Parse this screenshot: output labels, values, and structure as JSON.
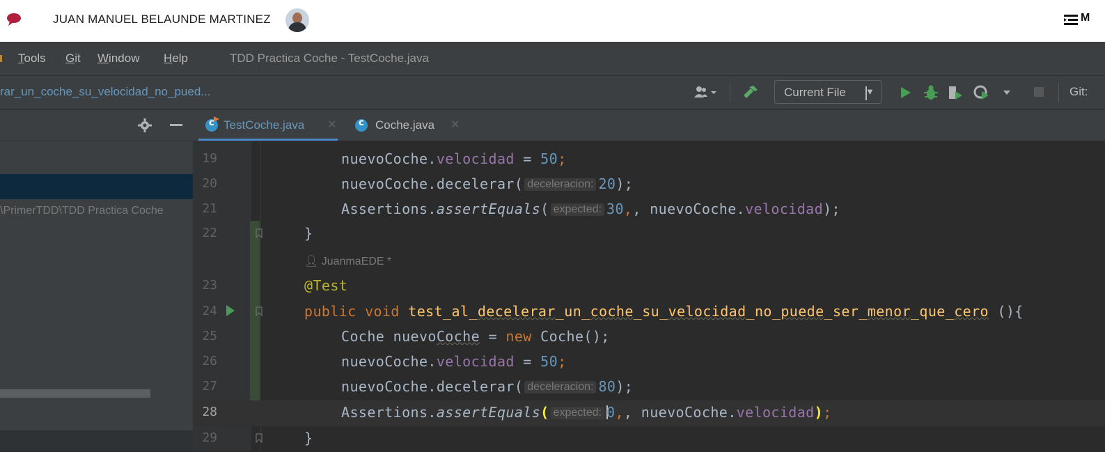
{
  "topbar": {
    "user_name": "JUAN MANUEL BELAUNDE MARTINEZ",
    "right_label": "M",
    "icons": [
      "chat-bubble-icon",
      "avatar",
      "menu-list-icon"
    ]
  },
  "menubar": {
    "items": [
      {
        "label": "Tools",
        "underline": "T",
        "rest": "ools"
      },
      {
        "label": "Git",
        "underline": "G",
        "rest": "it"
      },
      {
        "label": "Window",
        "underline": "W",
        "rest": "indow"
      },
      {
        "label": "Help",
        "underline": "H",
        "rest": "elp"
      }
    ],
    "window_title": "TDD Practica Coche - TestCoche.java"
  },
  "toolbar": {
    "breadcrumb": "rar_un_coche_su_velocidad_no_pued...",
    "run_config": "Current File",
    "git_label": "Git:",
    "icons": [
      "user-icon",
      "build-hammer-icon",
      "run-icon",
      "debug-icon",
      "coverage-icon",
      "profile-icon",
      "stop-icon"
    ]
  },
  "project_panel": {
    "path_text": "\\PrimerTDD\\TDD Practica Coche",
    "icons": [
      "gear-icon",
      "minimize-icon"
    ]
  },
  "tabs": [
    {
      "label": "TestCoche.java",
      "active": true
    },
    {
      "label": "Coche.java",
      "active": false
    }
  ],
  "editor": {
    "author_hint": "JuanmaEDE *",
    "lines": {
      "l19": {
        "num": "19",
        "obj": "nuevoCoche.",
        "field": "velocidad",
        "eq": " = ",
        "value": "50",
        "end": ";"
      },
      "l20": {
        "num": "20",
        "call": "nuevoCoche.decelerar(",
        "hint": "deceleracion:",
        "value": "20",
        "end": ");"
      },
      "l21": {
        "num": "21",
        "call": "Assertions.",
        "method": "assertEquals",
        "paren": "(",
        "hint": "expected:",
        "value": "30",
        "mid": ", nuevoCoche.",
        "field": "velocidad",
        "end": ");"
      },
      "l22": {
        "num": "22",
        "text": "}"
      },
      "l23": {
        "num": "23",
        "text": "@Test"
      },
      "l24": {
        "num": "24",
        "kw": "public void ",
        "name_parts": [
          "test_al_",
          "decelerar",
          "_un_",
          "coche",
          "_su_",
          "velocidad",
          "_no_",
          "puede",
          "_ser_",
          "menor",
          "_que_",
          "cero"
        ],
        "end": " (){"
      },
      "l25": {
        "num": "25",
        "type": "Coche nuevo",
        "var_squig": "Coche",
        "eq": " = ",
        "kw": "new",
        "rest": " Coche();"
      },
      "l26": {
        "num": "26",
        "obj": "nuevoCoche.",
        "field": "velocidad",
        "eq": " = ",
        "value": "50",
        "end": ";"
      },
      "l27": {
        "num": "27",
        "call": "nuevoCoche.decelerar(",
        "hint": "deceleracion:",
        "value": "80",
        "end": ");"
      },
      "l28": {
        "num": "28",
        "call": "Assertions.",
        "method": "assertEquals",
        "paren": "(",
        "hint": "expected:",
        "value": "0",
        "mid": ", nuevoCoche.",
        "field": "velocidad",
        "close": ")",
        "end": ";"
      },
      "l29": {
        "num": "29",
        "text": "}"
      }
    }
  },
  "colors": {
    "keyword": "#cc7832",
    "number": "#6897bb",
    "field": "#9876aa",
    "method": "#ffc66d",
    "annotation": "#bbb529",
    "accent_blue": "#4a88c7"
  }
}
